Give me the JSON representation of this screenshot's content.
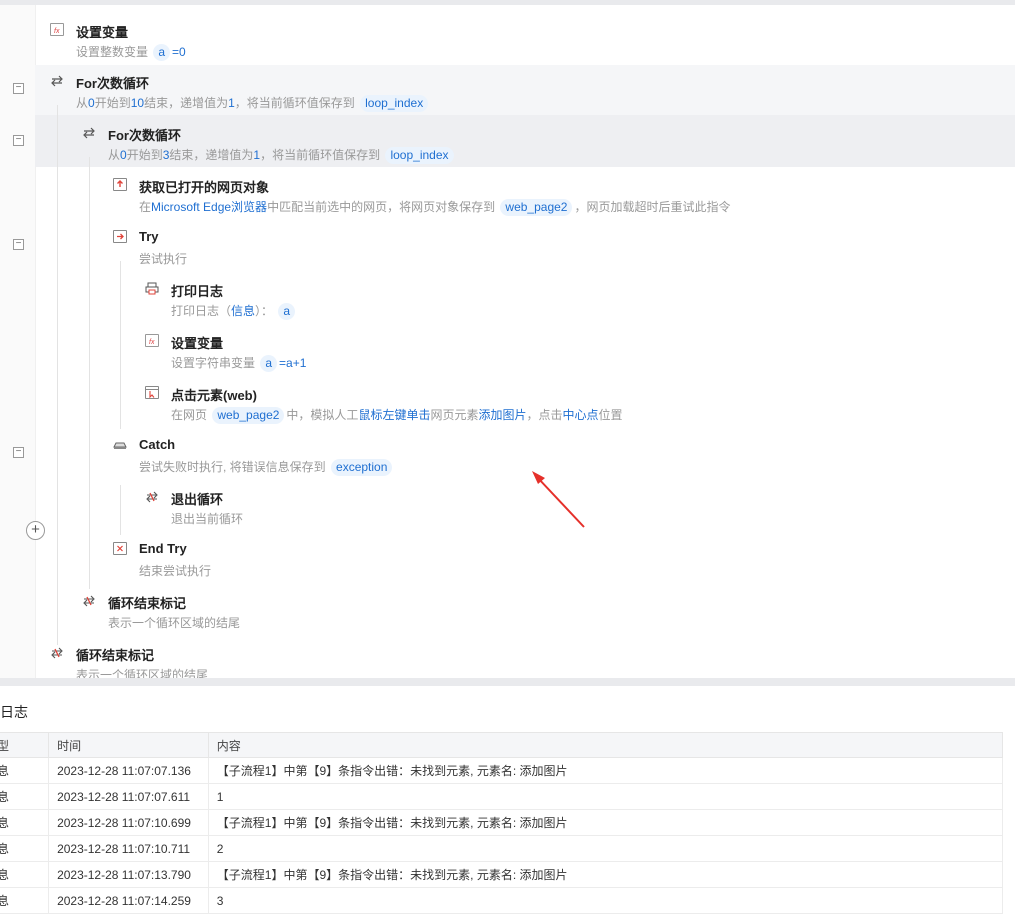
{
  "steps": {
    "s1": {
      "title": "设置变量",
      "d1": "设置整数变量",
      "var": "a",
      "d2": "=0"
    },
    "s2": {
      "title": "For次数循环",
      "p1": "从",
      "n1": "0",
      "p2": "开始到",
      "n2": "10",
      "p3": "结束，递增值为",
      "n3": "1",
      "p4": "，将当前循环值保存到",
      "var": "loop_index"
    },
    "s3": {
      "title": "For次数循环",
      "p1": "从",
      "n1": "0",
      "p2": "开始到",
      "n2": "3",
      "p3": "结束，递增值为",
      "n3": "1",
      "p4": "，将当前循环值保存到",
      "var": "loop_index"
    },
    "s4": {
      "title": "获取已打开的网页对象",
      "p1": "在",
      "browser": "Microsoft Edge浏览器",
      "p2": "中匹配当前选中的网页，将网页对象保存到",
      "var": "web_page2",
      "p3": "，网页加载超时后重试此指令"
    },
    "s5": {
      "title": "Try",
      "desc": "尝试执行"
    },
    "s6": {
      "title": "打印日志",
      "p1": "打印日志（",
      "level": "信息",
      "p2": "）：",
      "var": "a"
    },
    "s7": {
      "title": "设置变量",
      "d1": "设置字符串变量",
      "var": "a",
      "d2": "=a+1"
    },
    "s8": {
      "title": "点击元素(web)",
      "p1": "在网页",
      "var": "web_page2",
      "p2": "中，模拟人工",
      "action": "鼠标左键单击",
      "p3": "网页元素",
      "element": "添加图片",
      "p4": "，点击",
      "pos": "中心点",
      "p5": "位置"
    },
    "s9": {
      "title": "Catch",
      "d1": "尝试失败时执行, 将错误信息保存到",
      "var": "exception"
    },
    "s10": {
      "title": "退出循环",
      "desc": "退出当前循环"
    },
    "s11": {
      "title": "End Try",
      "desc": "结束尝试执行"
    },
    "s12": {
      "title": "循环结束标记",
      "desc": "表示一个循环区域的结尾"
    },
    "s13": {
      "title": "循环结束标记",
      "desc": "表示一个循环区域的结尾"
    }
  },
  "log": {
    "title": "日志",
    "headers": [
      "型",
      "时间",
      "内容"
    ],
    "rows": [
      {
        "type": "息",
        "time": "2023-12-28 11:07:07.136",
        "content": "【子流程1】中第【9】条指令出错：未找到元素, 元素名: 添加图片"
      },
      {
        "type": "息",
        "time": "2023-12-28 11:07:07.611",
        "content": "1"
      },
      {
        "type": "息",
        "time": "2023-12-28 11:07:10.699",
        "content": "【子流程1】中第【9】条指令出错：未找到元素, 元素名: 添加图片"
      },
      {
        "type": "息",
        "time": "2023-12-28 11:07:10.711",
        "content": "2"
      },
      {
        "type": "息",
        "time": "2023-12-28 11:07:13.790",
        "content": "【子流程1】中第【9】条指令出错：未找到元素, 元素名: 添加图片"
      },
      {
        "type": "息",
        "time": "2023-12-28 11:07:14.259",
        "content": "3"
      }
    ]
  },
  "colors": {
    "accent": "#1f6fd1",
    "arrow": "#e5302a",
    "tag_bg": "#eaf3fd"
  }
}
